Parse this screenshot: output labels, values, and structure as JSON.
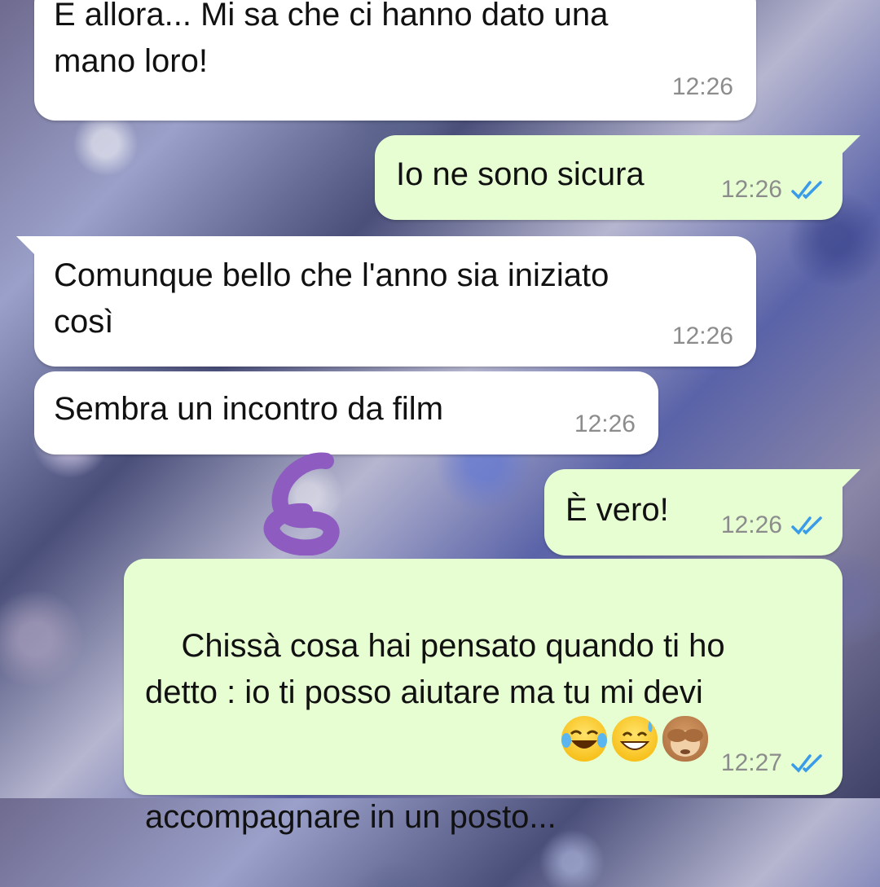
{
  "messages": [
    {
      "direction": "incoming",
      "text": "E allora... Mi sa che ci hanno dato una\nmano loro!",
      "time": "12:26"
    },
    {
      "direction": "outgoing",
      "text": "Io ne sono sicura",
      "time": "12:26",
      "status": "read"
    },
    {
      "direction": "incoming",
      "text": "Comunque bello che l'anno sia iniziato\ncosì",
      "time": "12:26"
    },
    {
      "direction": "incoming",
      "text": "Sembra un incontro da film",
      "time": "12:26"
    },
    {
      "direction": "outgoing",
      "text": "È vero!",
      "time": "12:26",
      "status": "read"
    },
    {
      "direction": "outgoing",
      "text": "Chissà cosa hai pensato quando ti ho\ndetto : io ti posso aiutare ma tu mi devi\naccompagnare in un posto...",
      "time": "12:27",
      "status": "read",
      "emojis": [
        "face-with-tears-of-joy",
        "grinning-face-with-sweat",
        "see-no-evil-monkey"
      ]
    }
  ],
  "colors": {
    "incoming_bubble": "#ffffff",
    "outgoing_bubble": "#e7fed3",
    "read_ticks": "#3a9be8",
    "timestamp": "#8c8c8c",
    "scribble": "#8e5cc0"
  }
}
